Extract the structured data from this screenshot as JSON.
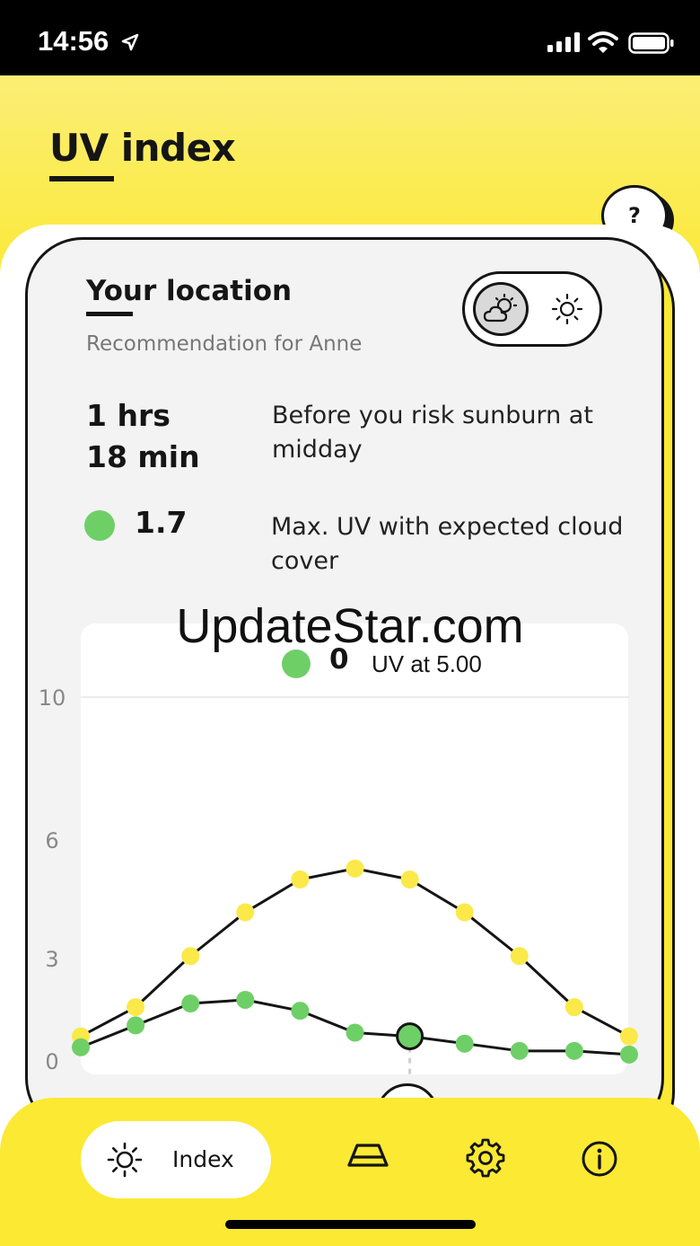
{
  "status_bar": {
    "time": "14:56"
  },
  "header": {
    "title": "UV index",
    "help_label": "?"
  },
  "location": {
    "title": "Your location",
    "subtitle": "Recommendation for Anne"
  },
  "toggle": {
    "options": [
      "cloud-sun-icon",
      "sun-icon"
    ],
    "selected": "cloud-sun-icon"
  },
  "sunburn": {
    "time_value": "1 hrs\n18 min",
    "description": "Before you risk sunburn at midday"
  },
  "max_uv": {
    "value": "1.7",
    "description": "Max. UV with expected cloud cover",
    "color": "#6fcf67"
  },
  "current": {
    "value": "0",
    "label": "UV at 5.00"
  },
  "watermark": "UpdateStar.com",
  "nav": {
    "active_label": "Index",
    "items": [
      "sun-icon",
      "lamp-icon",
      "gear-icon",
      "info-icon"
    ]
  },
  "colors": {
    "brand_yellow": "#fbe934",
    "green": "#6fcf67",
    "yellow_point": "#fbe94a",
    "dark": "#151515"
  },
  "chart_data": {
    "type": "line",
    "y_ticks": [
      "10",
      "6",
      "3",
      "0"
    ],
    "ylim": [
      0,
      10
    ],
    "x": [
      0,
      1,
      2,
      3,
      4,
      5,
      6,
      7,
      8,
      9,
      10
    ],
    "series": [
      {
        "values": [
          0.7,
          1.5,
          2.9,
          4.1,
          5.0,
          5.3,
          5.0,
          4.1,
          2.9,
          1.5,
          0.7
        ],
        "color": "#fbe94a"
      },
      {
        "values": [
          0.4,
          1.0,
          1.6,
          1.7,
          1.4,
          0.8,
          0.7,
          0.5,
          0.3,
          0.3,
          0.2
        ],
        "color": "#6fcf67"
      }
    ],
    "selected_index": 6,
    "grid": true
  }
}
